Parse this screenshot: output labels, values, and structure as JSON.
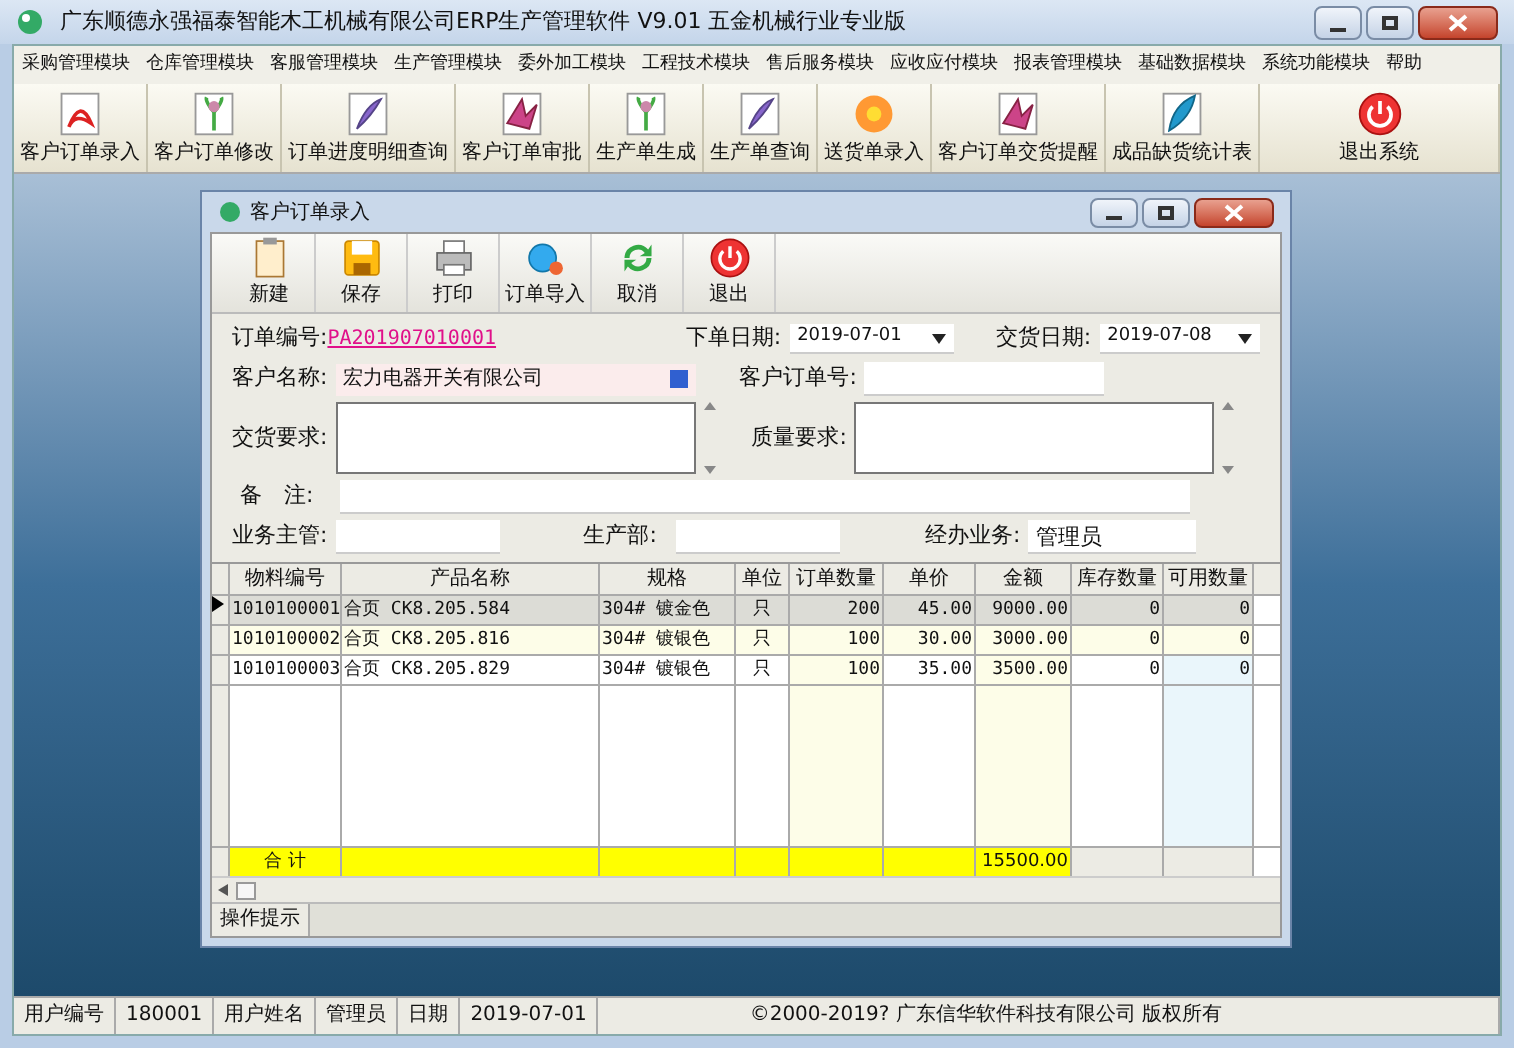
{
  "window": {
    "title": "广东顺德永强福泰智能木工机械有限公司ERP生产管理软件  V9.01 五金机械行业专业版"
  },
  "menu": [
    "采购管理模块",
    "仓库管理模块",
    "客服管理模块",
    "生产管理模块",
    "委外加工模块",
    "工程技术模块",
    "售后服务模块",
    "应收应付模块",
    "报表管理模块",
    "基础数据模块",
    "系统功能模块",
    "帮助"
  ],
  "toolbar": [
    {
      "label": "客户订单录入",
      "kind": "pdf"
    },
    {
      "label": "客户订单修改",
      "kind": "flower"
    },
    {
      "label": "订单进度明细查询",
      "kind": "feather"
    },
    {
      "label": "客户订单审批",
      "kind": "bird"
    },
    {
      "label": "生产单生成",
      "kind": "flower"
    },
    {
      "label": "生产单查询",
      "kind": "feather"
    },
    {
      "label": "送货单录入",
      "kind": "sun"
    },
    {
      "label": "客户订单交货提醒",
      "kind": "bird"
    },
    {
      "label": "成品缺货统计表",
      "kind": "quill"
    },
    {
      "label": "退出系统",
      "kind": "power"
    }
  ],
  "order_window": {
    "title": "客户订单录入",
    "toolbar": [
      {
        "label": "新建",
        "kind": "clipboard"
      },
      {
        "label": "保存",
        "kind": "disk"
      },
      {
        "label": "打印",
        "kind": "printer"
      },
      {
        "label": "订单导入",
        "kind": "import"
      },
      {
        "label": "取消",
        "kind": "refresh"
      },
      {
        "label": "退出",
        "kind": "power"
      }
    ],
    "form": {
      "order_no_label": "订单编号:",
      "order_no": "PA201907010001",
      "order_date_label": "下单日期:",
      "order_date": "2019-07-01",
      "delivery_date_label": "交货日期:",
      "delivery_date": "2019-07-08",
      "customer_label": "客户名称:",
      "customer": "宏力电器开关有限公司",
      "customer_order_label": "客户订单号:",
      "delivery_req_label": "交货要求:",
      "quality_req_label": "质量要求:",
      "remarks_label": "备　注:",
      "supervisor_label": "业务主管:",
      "production_label": "生产部:",
      "handler_label": "经办业务:",
      "handler": "管理员"
    },
    "table": {
      "columns": [
        "物料编号",
        "产品名称",
        "规格",
        "单位",
        "订单数量",
        "单价",
        "金额",
        "库存数量",
        "可用数量"
      ],
      "rows": [
        {
          "selected": true,
          "cells": [
            "1010100001",
            "合页 CK8.205.584",
            "304# 镀金色",
            "只",
            "200",
            "45.00",
            "9000.00",
            "0",
            "0"
          ]
        },
        {
          "selected": false,
          "cells": [
            "1010100002",
            "合页 CK8.205.816",
            "304# 镀银色",
            "只",
            "100",
            "30.00",
            "3000.00",
            "0",
            "0"
          ]
        },
        {
          "selected": false,
          "cells": [
            "1010100003",
            "合页 CK8.205.829",
            "304# 镀银色",
            "只",
            "100",
            "35.00",
            "3500.00",
            "0",
            "0"
          ]
        }
      ],
      "total_label": "合 计",
      "total_amount": "15500.00"
    },
    "hint_label": "操作提示"
  },
  "status_bar": [
    "用户编号",
    "180001",
    "用户姓名",
    "管理员",
    "日期",
    "2019-07-01",
    "©2000-2019?  广东信华软件科技有限公司    版权所有"
  ]
}
